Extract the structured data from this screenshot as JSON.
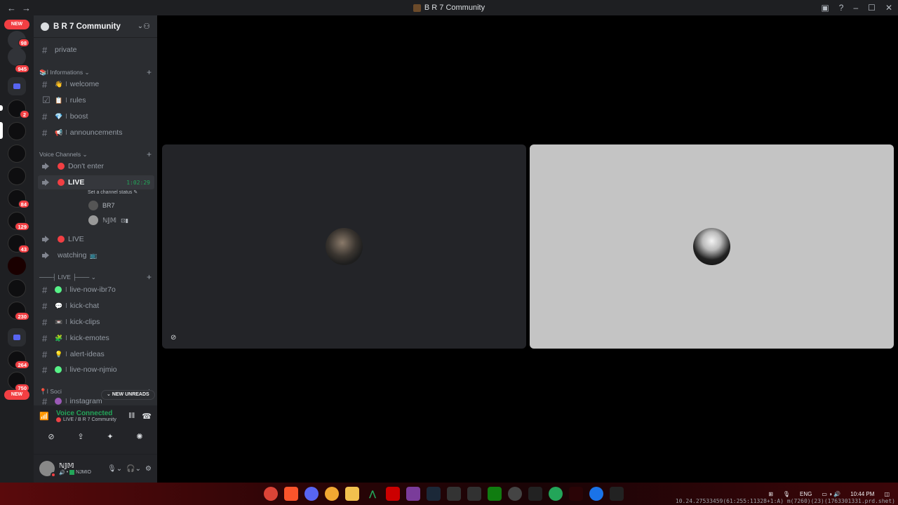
{
  "window": {
    "title": "B R 7 Community",
    "back_icon": "←",
    "forward_icon": "→",
    "inbox_icon": "▣",
    "help_icon": "?",
    "minimize": "–",
    "maximize": "☐",
    "close": "✕"
  },
  "rail": {
    "new_label_top": "NEW",
    "new_label_bottom": "NEW",
    "servers": [
      {
        "badge": "98"
      },
      {
        "badge": "945"
      },
      {
        "badge": "2"
      },
      {
        "badge": "84"
      },
      {
        "badge": "129"
      },
      {
        "badge": "43"
      },
      {
        "badge": "230"
      },
      {
        "badge": "264"
      },
      {
        "badge": "750"
      }
    ]
  },
  "server": {
    "name": "B R 7 Community",
    "chevron": "⌄",
    "invite_icon": "⚇"
  },
  "channels": {
    "private": "private",
    "cat_informations": "Informations",
    "welcome": "welcome",
    "rules": "rules",
    "boost": "boost",
    "announcements": "announcements",
    "cat_voice": "Voice Channels",
    "dont_enter": "Don't enter",
    "live1": "LIVE",
    "live1_timer": "1:02:29",
    "live1_status": "Set a channel status",
    "user1": "BR7",
    "user2": "ℕ𝕁𝕄",
    "live2": "LIVE",
    "watching": "watching",
    "cat_live": "───┤ LIVE ├───",
    "live_now_ibr7o": "live-now-ibr7o",
    "kick_chat": "kick-chat",
    "kick_clips": "kick-clips",
    "kick_emotes": "kick-emotes",
    "alert_ideas": "alert-ideas",
    "live_now_njmio": "live-now-njmio",
    "cat_social": "Soci",
    "instagram": "instagram",
    "new_unreads": "NEW UNREADS",
    "separator": "ا"
  },
  "voice": {
    "title": "Voice Connected",
    "subtitle": "LIVE / B R 7 Community"
  },
  "user": {
    "display_name": "ℕ𝕁𝕄",
    "tag": "NJMIO"
  },
  "taskbar": {
    "lang": "ENG",
    "time": "10:44 PM",
    "status": "10.24.27533459(61:255:11328+1:A) m(7260)(23)(1763301331.prd.shet)"
  },
  "colors": {
    "accent_red": "#f23f43",
    "connected_green": "#23a559",
    "rail_bg": "#1e1f22",
    "sidebar_bg": "#2b2d31"
  }
}
